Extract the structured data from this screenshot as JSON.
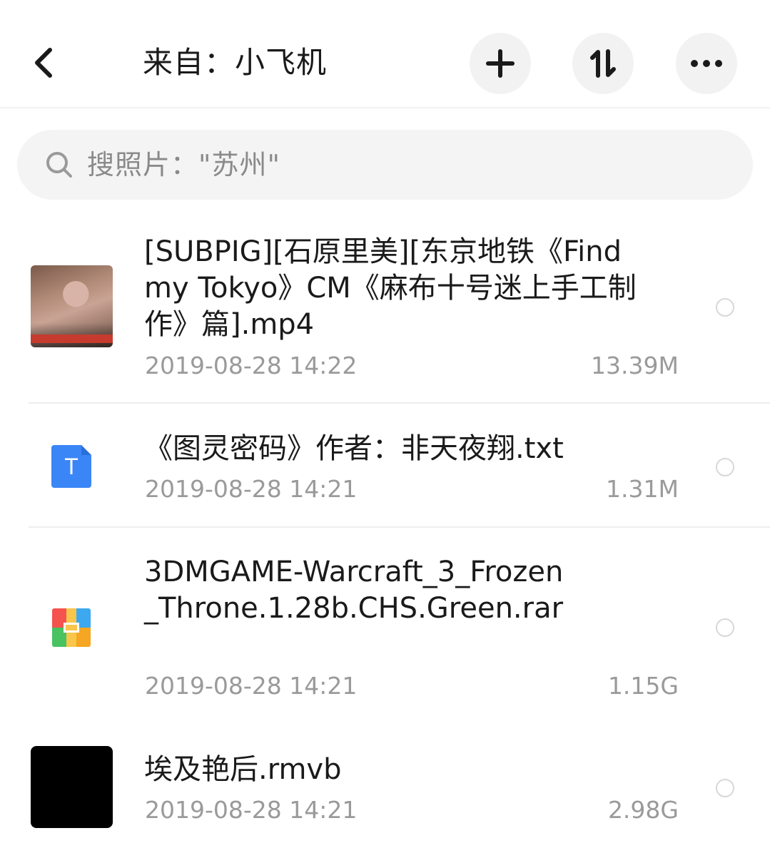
{
  "header": {
    "title": "来自：小飞机",
    "back_icon": "chevron-left-icon",
    "add_icon": "plus-icon",
    "sort_icon": "sort-icon",
    "more_icon": "ellipsis-icon"
  },
  "search": {
    "placeholder": "搜照片：\"苏州\""
  },
  "files": [
    {
      "name": "[SUBPIG][石原里美][东京地铁《Find my Tokyo》CM《麻布十号迷上手工制作》篇].mp4",
      "date": "2019-08-28 14:22",
      "size": "13.39M",
      "thumb": "video-thumbnail"
    },
    {
      "name": "《图灵密码》作者：非天夜翔.txt",
      "date": "2019-08-28 14:21",
      "size": "1.31M",
      "thumb": "txt-file-icon",
      "thumb_letter": "T"
    },
    {
      "name": "3DMGAME-Warcraft_3_Frozen_Throne.1.28b.CHS.Green.rar",
      "date": "2019-08-28 14:21",
      "size": "1.15G",
      "thumb": "rar-archive-icon"
    },
    {
      "name": "埃及艳后.rmvb",
      "date": "2019-08-28 14:21",
      "size": "2.98G",
      "thumb": "video-thumbnail-black"
    }
  ],
  "colors": {
    "accent_blue": "#3b86f7",
    "text_primary": "#1a1a1a",
    "text_secondary": "#9a9a9a",
    "button_bg": "#f2f2f2"
  }
}
